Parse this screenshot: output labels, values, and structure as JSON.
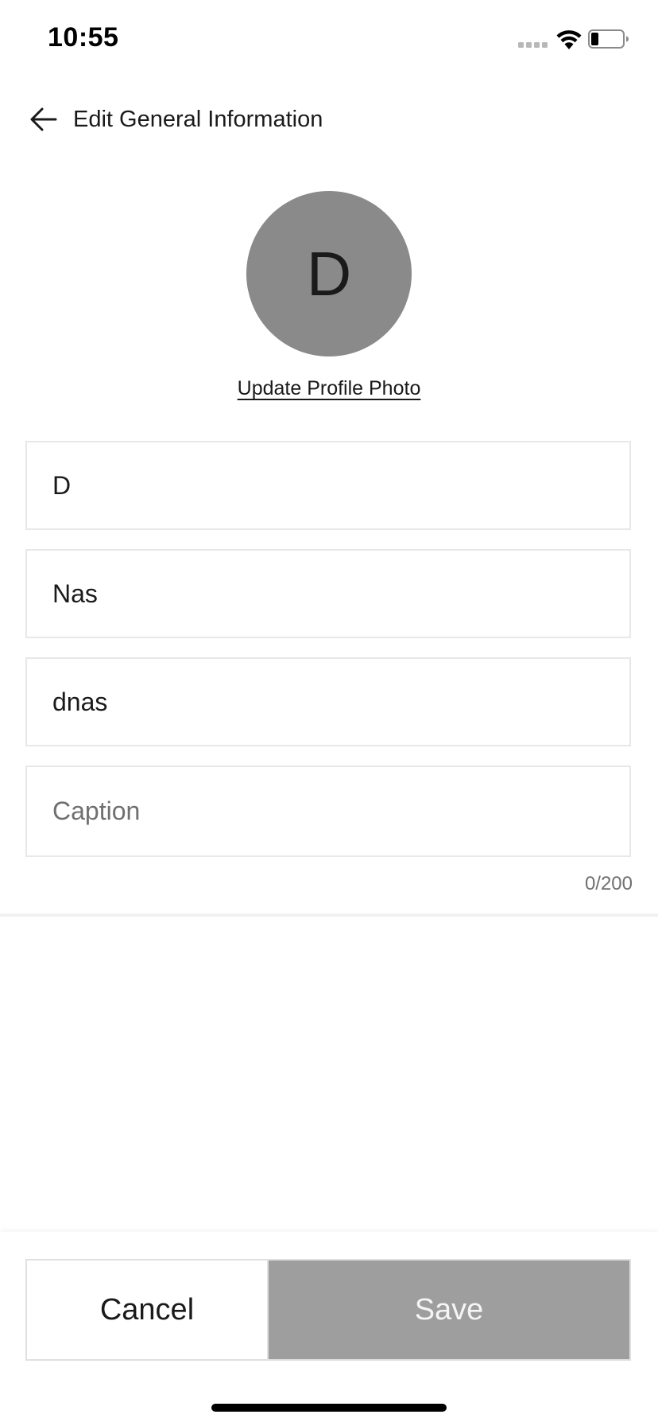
{
  "status_bar": {
    "time": "10:55",
    "icons": [
      "cellular-signal-icon",
      "wifi-icon",
      "battery-icon"
    ],
    "battery_level": 0.2
  },
  "header": {
    "back_icon": "arrow-left-icon",
    "title": "Edit General Information"
  },
  "profile": {
    "avatar_initial": "D",
    "avatar_color": "#8a8a8a",
    "update_photo_label": "Update Profile Photo"
  },
  "form": {
    "first_name": {
      "value": "D",
      "placeholder": ""
    },
    "last_name": {
      "value": "Nas",
      "placeholder": ""
    },
    "username": {
      "value": "dnas",
      "placeholder": ""
    },
    "caption": {
      "value": "",
      "placeholder": "Caption",
      "counter": "0/200"
    }
  },
  "actions": {
    "cancel_label": "Cancel",
    "save_label": "Save",
    "save_color": "#9e9e9e"
  }
}
